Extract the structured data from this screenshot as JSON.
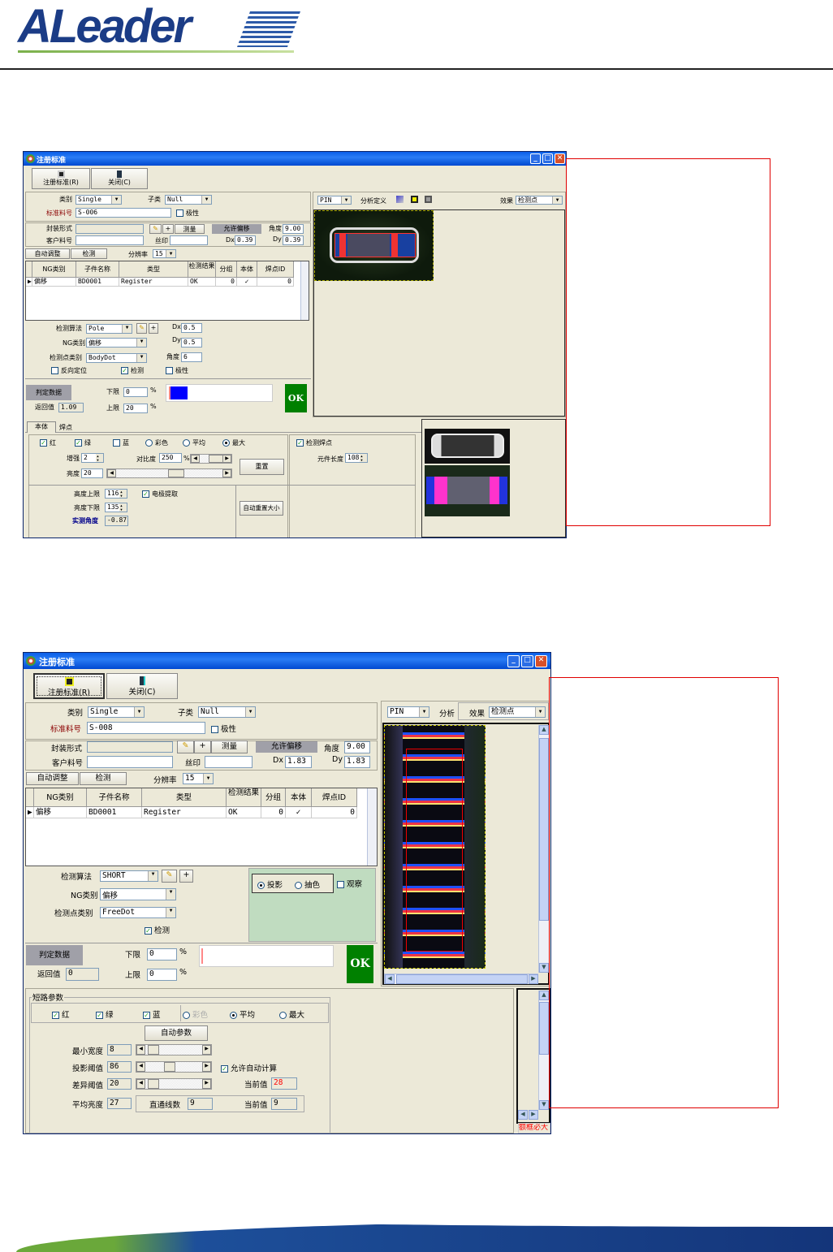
{
  "header": {
    "logo": "ALeader"
  },
  "window1": {
    "title": "注册标准",
    "toolbar": {
      "register": "注册标准(R)",
      "close": "关闭(C)"
    },
    "category_label": "类别",
    "category": "Single",
    "subcategory_label": "子类",
    "subcategory": "Null",
    "std_part_label": "标准料号",
    "std_part": "S-006",
    "polarity_label": "极性",
    "package_label": "封装形式",
    "package": "",
    "measure": "测量",
    "allow_offset": "允许偏移",
    "angle_label": "角度",
    "angle": "9.00",
    "customer_part_label": "客户料号",
    "customer_part": "",
    "silk_label": "丝印",
    "silk": "",
    "dx_label": "Dx",
    "dx": "0.39",
    "dy_label": "Dy",
    "dy": "0.39",
    "auto_adjust": "自动调整",
    "detect": "检测",
    "resolution_label": "分辨率",
    "resolution": "15",
    "grid": {
      "columns": [
        "NG类别",
        "子件名称",
        "类型",
        "检测结果",
        "分组",
        "本体",
        "焊点ID"
      ],
      "rows": [
        [
          "偏移",
          "BD0001",
          "Register",
          "OK",
          "0",
          "✓",
          "0"
        ]
      ]
    },
    "algo_label": "检测算法",
    "algo": "Pole",
    "ng_label": "NG类别",
    "ng": "偏移",
    "point_label": "检测点类别",
    "point": "BodyDot",
    "dx2": "0.5",
    "dy2": "0.5",
    "angle2": "6",
    "reverse_label": "反向定位",
    "detect_check_label": "检测",
    "polarity2_label": "极性",
    "judge": "判定数据",
    "lower_label": "下限",
    "lower": "0",
    "upper_label": "上限",
    "upper": "20",
    "pct": "%",
    "return_label": "返回值",
    "return_value": "1.09",
    "ok": "OK",
    "judge_bar_fill_percent": 18,
    "tabs": [
      "本体",
      "焊点"
    ],
    "red": "红",
    "green": "绿",
    "blue": "蓝",
    "color": "彩色",
    "average": "平均",
    "max": "最大",
    "enhance_label": "增强",
    "enhance": "2",
    "contrast_label": "对比度",
    "contrast": "250",
    "brightness_label": "亮度",
    "brightness": "20",
    "reset": "重置",
    "detect_pad": "检测焊点",
    "comp_len_label": "元件长度",
    "comp_len": "108",
    "height_upper_label": "高度上限",
    "height_upper": "116",
    "bright_lower_label": "亮度下限",
    "bright_lower": "135",
    "electrode": "电极提取",
    "angle_meas_label": "实测角度",
    "angle_meas": "-0.87",
    "auto_resize": "自动重置大小",
    "view": {
      "mode": "PIN",
      "analysis": "分析定义",
      "effect_label": "效果",
      "effect": "检测点"
    }
  },
  "window2": {
    "title": "注册标准",
    "toolbar": {
      "register": "注册标准(R)",
      "close": "关闭(C)"
    },
    "category_label": "类别",
    "category": "Single",
    "subcategory_label": "子类",
    "subcategory": "Null",
    "std_part_label": "标准料号",
    "std_part": "S-008",
    "polarity_label": "极性",
    "package_label": "封装形式",
    "measure": "测量",
    "allow_offset": "允许偏移",
    "angle_label": "角度",
    "angle": "9.00",
    "customer_part_label": "客户料号",
    "silk_label": "丝印",
    "dx_label": "Dx",
    "dx": "1.83",
    "dy_label": "Dy",
    "dy": "1.83",
    "auto_adjust": "自动调整",
    "detect": "检测",
    "resolution_label": "分辨率",
    "resolution": "15",
    "grid": {
      "columns": [
        "NG类别",
        "子件名称",
        "类型",
        "检测结果",
        "分组",
        "本体",
        "焊点ID"
      ],
      "rows": [
        [
          "偏移",
          "BD0001",
          "Register",
          "OK",
          "0",
          "✓",
          "0"
        ]
      ]
    },
    "algo_label": "检测算法",
    "algo": "SHORT",
    "ng_label": "NG类别",
    "ng": "偏移",
    "point_label": "检测点类别",
    "point": "FreeDot",
    "detect_check_label": "检测",
    "projection": "投影",
    "extract": "抽色",
    "observe": "观察",
    "judge": "判定数据",
    "lower_label": "下限",
    "lower": "0",
    "upper_label": "上限",
    "upper": "0",
    "pct": "%",
    "return_label": "返回值",
    "return_value": "0",
    "ok": "OK",
    "short_group": "短路参数",
    "red": "红",
    "green": "绿",
    "blue": "蓝",
    "color": "彩色",
    "average": "平均",
    "max": "最大",
    "auto_param": "自动参数",
    "min_width_label": "最小宽度",
    "min_width": "8",
    "proj_thresh_label": "投影阈值",
    "proj_thresh": "86",
    "allow_auto": "允许自动计算",
    "diff_thresh_label": "差异阈值",
    "diff_thresh": "20",
    "current_label": "当前值",
    "current": "28",
    "avg_bright_label": "平均亮度",
    "avg_bright": "27",
    "lines_label": "直通线数",
    "lines": "9",
    "current2": "9",
    "note": "额框必大",
    "view": {
      "mode": "PIN",
      "analysis": "分析",
      "effect_label": "效果",
      "effect": "检测点"
    }
  },
  "colors": {
    "annotation_box": "#e00000",
    "ok": "#008000",
    "titlebar": "#0a5ee8",
    "brand": "#1b3c86"
  }
}
